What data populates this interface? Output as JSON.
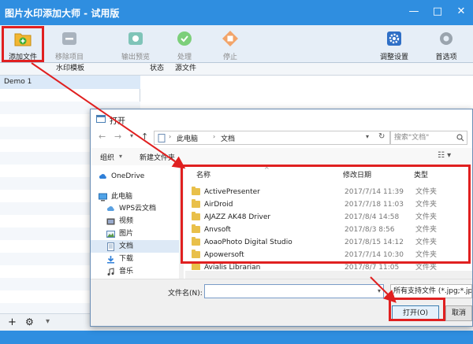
{
  "app": {
    "title": "图片水印添加大师 - 试用版",
    "window_controls": {
      "min": "—",
      "max": "□",
      "close": "✕"
    },
    "toolbar": {
      "add_file": "添加文件",
      "remove_item": "移除项目",
      "output_preview": "输出预览",
      "process": "处理",
      "stop": "停止",
      "adjust_settings": "调整设置",
      "options": "首选项"
    },
    "left_panel": {
      "header": "水印模板",
      "items": [
        "Demo 1"
      ]
    },
    "right_panel": {
      "headers": {
        "status": "状态",
        "source_file": "源文件"
      }
    },
    "bottom_bar": {
      "add": "+",
      "settings": "⚙",
      "dropdown": "▾"
    }
  },
  "dialog": {
    "title": "打开",
    "breadcrumb": [
      "此电脑",
      "文档"
    ],
    "search_placeholder": "搜索\"文档\"",
    "organize": "组织",
    "new_folder": "新建文件夹",
    "nav_items": [
      {
        "label": "OneDrive",
        "icon": "cloud-icon"
      },
      {
        "label": "此电脑",
        "icon": "computer-icon"
      },
      {
        "label": "WPS云文档",
        "icon": "cloud-doc-icon"
      },
      {
        "label": "视频",
        "icon": "video-icon"
      },
      {
        "label": "图片",
        "icon": "picture-icon"
      },
      {
        "label": "文档",
        "icon": "document-icon"
      },
      {
        "label": "下载",
        "icon": "download-icon"
      },
      {
        "label": "音乐",
        "icon": "music-icon"
      }
    ],
    "columns": {
      "name": "名称",
      "modified": "修改日期",
      "type": "类型"
    },
    "files": [
      {
        "name": "ActivePresenter",
        "modified": "2017/7/14 11:39",
        "type": "文件夹"
      },
      {
        "name": "AirDroid",
        "modified": "2017/7/18 11:03",
        "type": "文件夹"
      },
      {
        "name": "AJAZZ AK48 Driver",
        "modified": "2017/8/4 14:58",
        "type": "文件夹"
      },
      {
        "name": "Anvsoft",
        "modified": "2017/8/3 8:56",
        "type": "文件夹"
      },
      {
        "name": "AoaoPhoto Digital Studio",
        "modified": "2017/8/15 14:12",
        "type": "文件夹"
      },
      {
        "name": "Apowersoft",
        "modified": "2017/7/14 10:30",
        "type": "文件夹"
      },
      {
        "name": "Avialis Librarian",
        "modified": "2017/8/7 11:05",
        "type": "文件夹"
      }
    ],
    "filename_label": "文件名(N):",
    "filename_value": "",
    "filetype_value": "所有支持文件 (*.jpg;*.jpe",
    "open_button": "打开(O)",
    "cancel_button": "取消"
  },
  "colors": {
    "title_blue": "#2f8ee0",
    "highlight_red": "#e02020",
    "folder_yellow": "#e9c04a",
    "selection_blue": "#dbe9f8"
  }
}
